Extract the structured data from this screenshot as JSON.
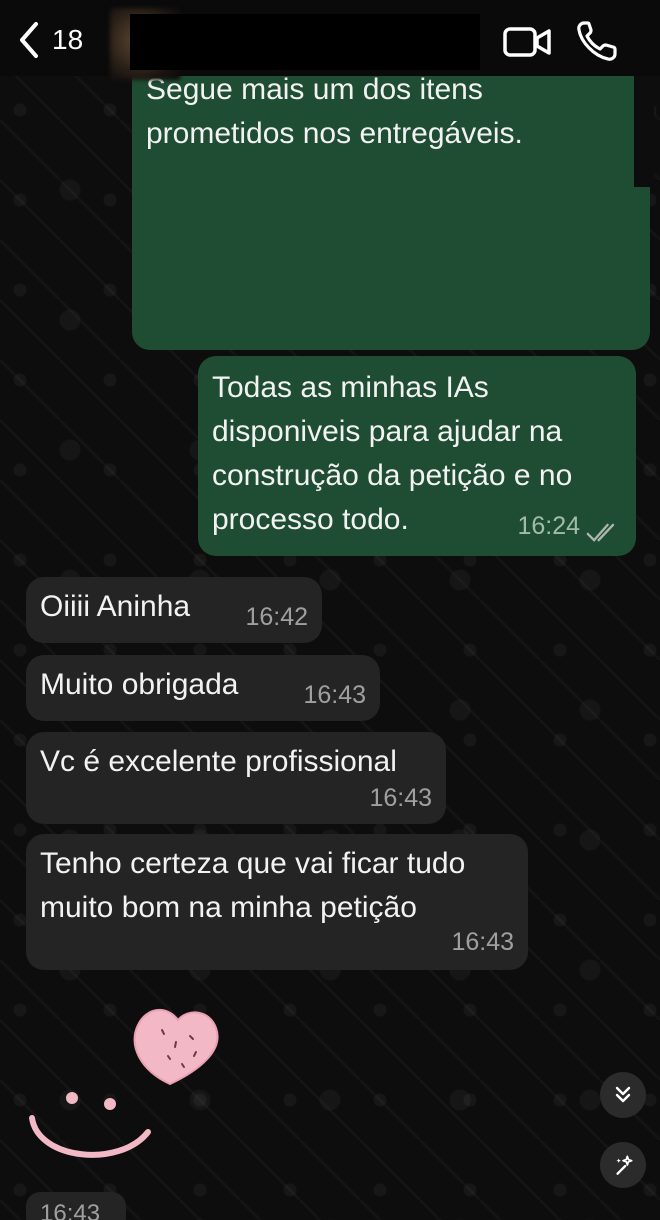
{
  "header": {
    "back_count": "18",
    "icons": [
      "chevron-left-icon",
      "video-camera-icon",
      "phone-icon"
    ]
  },
  "media_message": {
    "caption": "Segue mais um dos itens prometidos nos entregáveis."
  },
  "messages": [
    {
      "direction": "outgoing",
      "text": "Todas as minhas IAs disponiveis para ajudar na construção da petição e no processo todo.",
      "time": "16:24",
      "status": "read"
    },
    {
      "direction": "incoming",
      "text": "Oiiii Aninha",
      "time": "16:42"
    },
    {
      "direction": "incoming",
      "text": "Muito obrigada",
      "time": "16:43"
    },
    {
      "direction": "incoming",
      "text": "Vc é excelente profissional",
      "time": "16:43"
    },
    {
      "direction": "incoming",
      "text": "Tenho certeza que vai ficar tudo muito bom na minha petição",
      "time": "16:43"
    }
  ],
  "sticker": {
    "time": "16:43",
    "icons": [
      "heart-icon",
      "smiley-face-icon"
    ]
  },
  "floating_buttons": [
    "scroll-to-bottom-icon",
    "ai-sparkle-icon"
  ],
  "colors": {
    "outgoing_bubble": "#1f4d33",
    "incoming_bubble": "#242424",
    "background": "#0d0d0d",
    "sticker_heart": "#f2b8c6"
  }
}
